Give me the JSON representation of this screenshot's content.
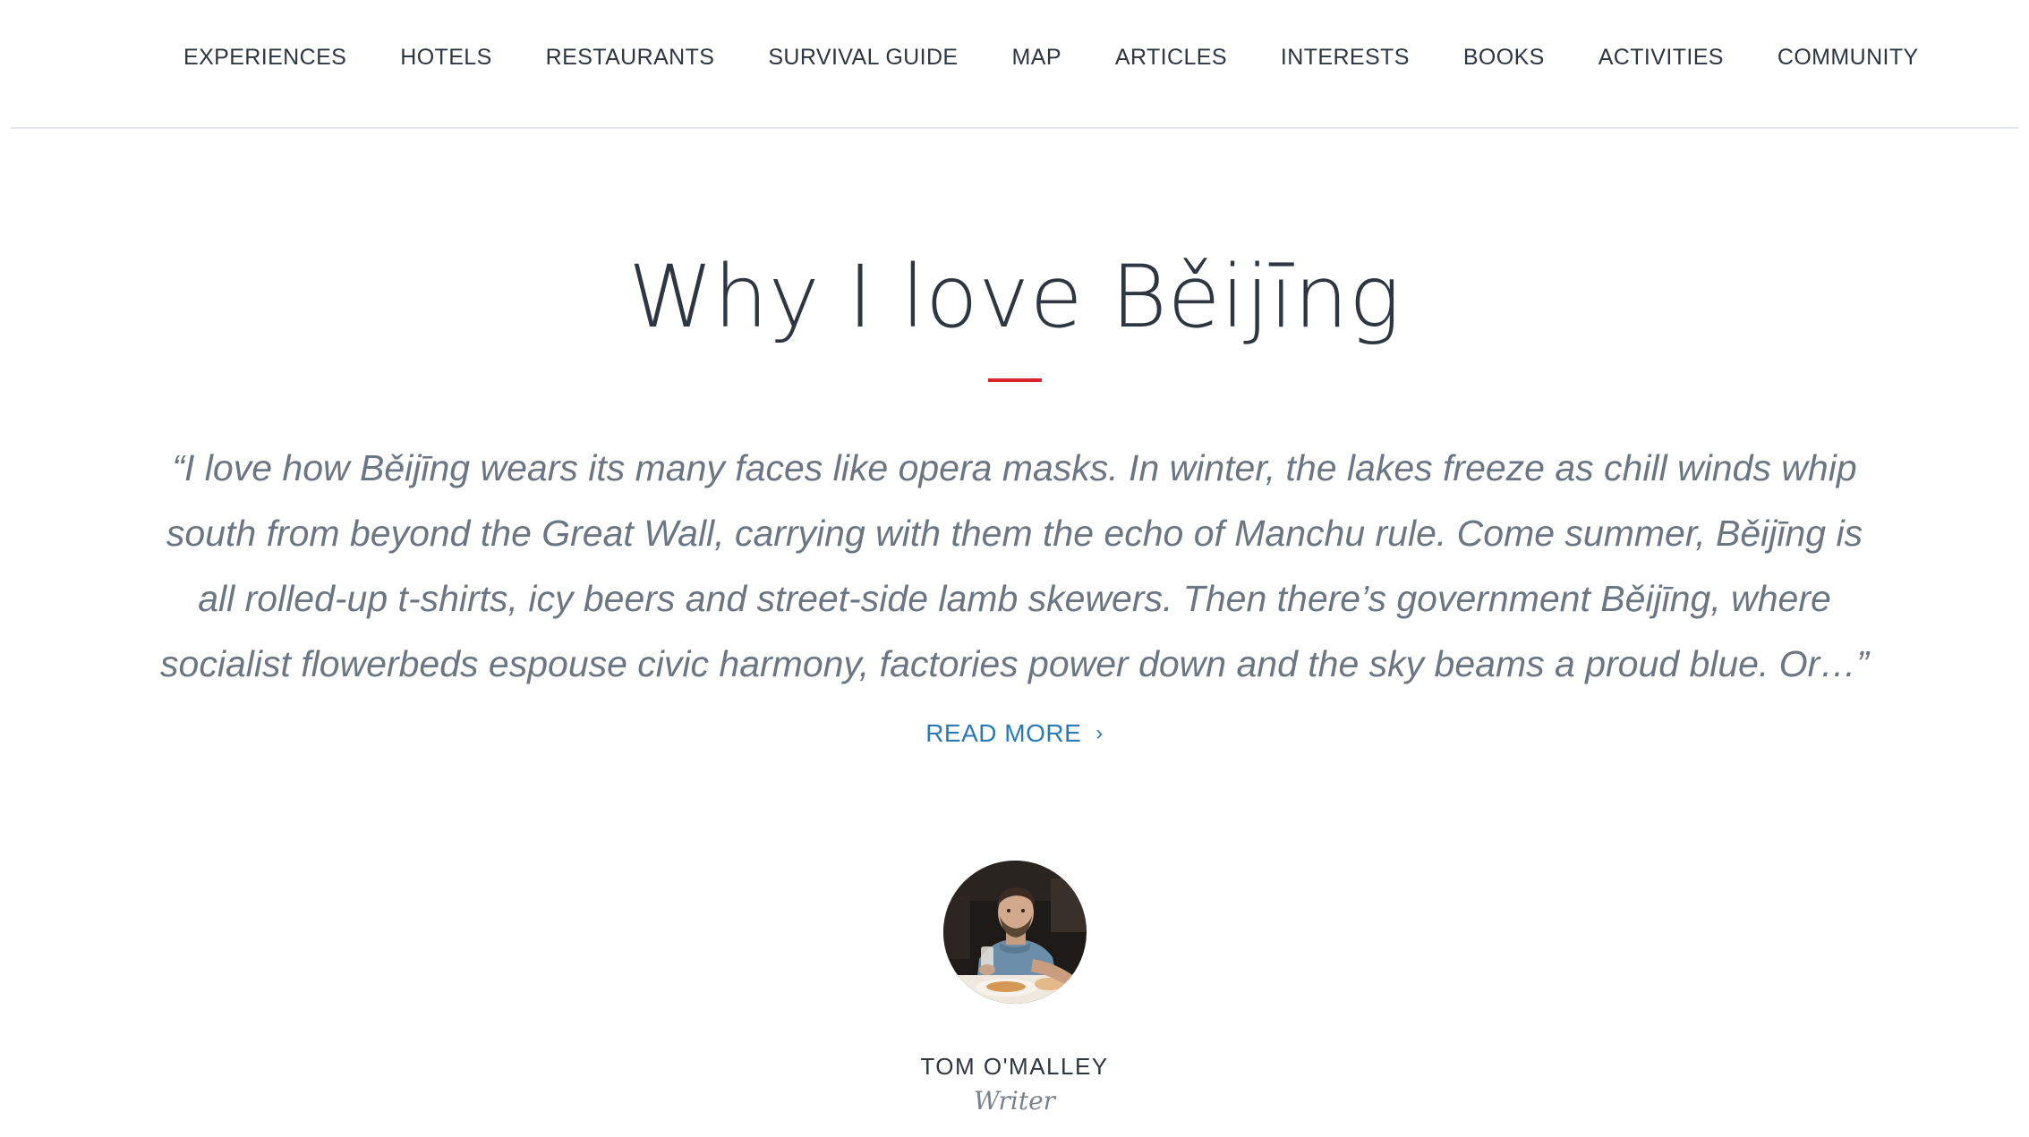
{
  "nav": {
    "items": [
      {
        "label": "EXPERIENCES"
      },
      {
        "label": "HOTELS"
      },
      {
        "label": "RESTAURANTS"
      },
      {
        "label": "SURVIVAL GUIDE"
      },
      {
        "label": "MAP"
      },
      {
        "label": "ARTICLES"
      },
      {
        "label": "INTERESTS"
      },
      {
        "label": "BOOKS"
      },
      {
        "label": "ACTIVITIES"
      },
      {
        "label": "COMMUNITY"
      }
    ]
  },
  "article": {
    "title": "Why I love Běijīng",
    "quote": "“I love how Běijīng wears its many faces like opera masks. In winter, the lakes freeze as chill winds whip south from beyond the Great Wall, carrying with them the echo of Manchu rule. Come summer, Běijīng is all rolled-up t-shirts, icy beers and street-side lamb skewers. Then there’s government Běijīng, where socialist flowerbeds espouse civic harmony, factories power down and the sky beams a proud blue. Or…”",
    "read_more_label": "READ MORE",
    "read_more_icon": "chevron-right-icon"
  },
  "author": {
    "name": "TOM O'MALLEY",
    "role": "Writer"
  },
  "colors": {
    "text": "#2e3641",
    "accent_rule": "#d8232a",
    "link": "#2a7ab8",
    "quote": "#6b7682"
  }
}
